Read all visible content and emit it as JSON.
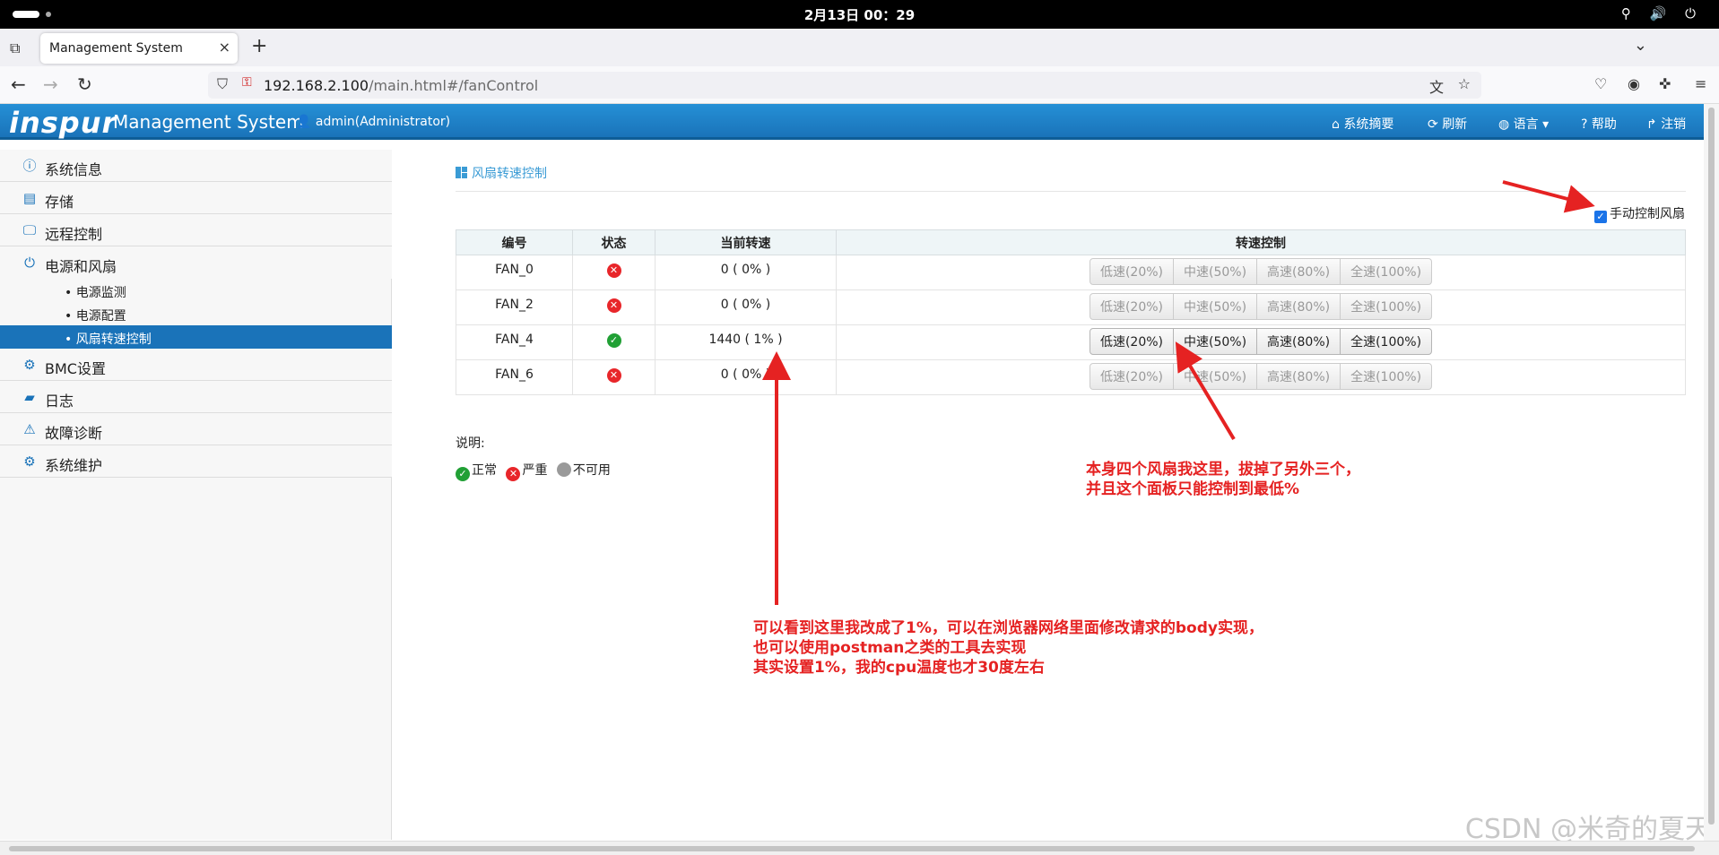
{
  "os": {
    "clock": "2月13日 00：29",
    "tray": "⚲ 🔊 ⏻"
  },
  "browser": {
    "tab_title": "Management System",
    "url_host": "192.168.2.100",
    "url_path": "/main.html#/fanControl"
  },
  "header": {
    "logo": "inspur",
    "title": "Management System",
    "user": "admin(Administrator)",
    "menu": [
      "系统摘要",
      "刷新",
      "语言",
      "帮助",
      "注销"
    ]
  },
  "sidebar": {
    "items": [
      {
        "label": "系统信息",
        "icon": "info-icon"
      },
      {
        "label": "存储",
        "icon": "storage-icon"
      },
      {
        "label": "远程控制",
        "icon": "monitor-icon"
      },
      {
        "label": "电源和风扇",
        "icon": "power-icon"
      },
      {
        "label": "BMC设置",
        "icon": "gear-icon"
      },
      {
        "label": "日志",
        "icon": "log-icon"
      },
      {
        "label": "故障诊断",
        "icon": "warning-icon"
      },
      {
        "label": "系统维护",
        "icon": "gears-icon"
      }
    ],
    "subitems": [
      "电源监测",
      "电源配置",
      "风扇转速控制"
    ]
  },
  "page": {
    "title": "风扇转速控制",
    "manual_label": "手动控制风扇",
    "manual_checked": true,
    "columns": [
      "编号",
      "状态",
      "当前转速",
      "转速控制"
    ],
    "speed_buttons": [
      "低速(20%)",
      "中速(50%)",
      "高速(80%)",
      "全速(100%)"
    ],
    "fans": [
      {
        "id": "FAN_0",
        "status": "error",
        "speed": "0 ( 0% )",
        "enabled": false
      },
      {
        "id": "FAN_2",
        "status": "error",
        "speed": "0 ( 0% )",
        "enabled": false
      },
      {
        "id": "FAN_4",
        "status": "ok",
        "speed": "1440 ( 1% )",
        "enabled": true
      },
      {
        "id": "FAN_6",
        "status": "error",
        "speed": "0 ( 0% )",
        "enabled": false
      }
    ],
    "legend_title": "说明:",
    "legend": [
      {
        "status": "ok",
        "label": "正常"
      },
      {
        "status": "error",
        "label": "严重"
      },
      {
        "status": "na",
        "label": "不可用"
      }
    ]
  },
  "annotations": {
    "right_line1": "本身四个风扇我这里，拔掉了另外三个，",
    "right_line2": "并且这个面板只能控制到最低%",
    "bottom_line1": "可以看到这里我改成了1%，可以在浏览器网络里面修改请求的body实现，",
    "bottom_line2": "也可以使用postman之类的工具去实现",
    "bottom_line3": "其实设置1%，我的cpu温度也才30度左右"
  },
  "watermark": "CSDN @米奇的夏天"
}
